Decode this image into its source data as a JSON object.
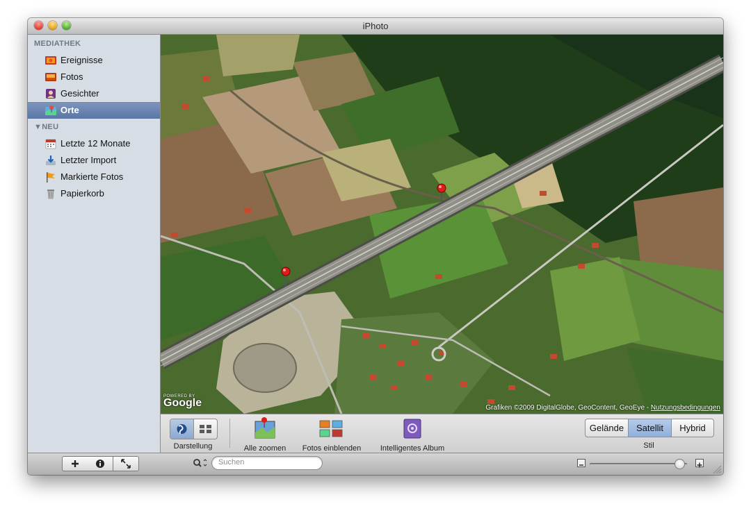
{
  "window": {
    "title": "iPhoto"
  },
  "sidebar": {
    "sections": [
      {
        "title": "MEDIATHEK",
        "items": [
          {
            "label": "Ereignisse",
            "icon": "events-icon",
            "selected": false
          },
          {
            "label": "Fotos",
            "icon": "photos-icon",
            "selected": false
          },
          {
            "label": "Gesichter",
            "icon": "faces-icon",
            "selected": false
          },
          {
            "label": "Orte",
            "icon": "places-icon",
            "selected": true
          }
        ]
      },
      {
        "title": "NEU",
        "items": [
          {
            "label": "Letzte 12 Monate",
            "icon": "calendar-icon",
            "selected": false
          },
          {
            "label": "Letzter Import",
            "icon": "import-icon",
            "selected": false
          },
          {
            "label": "Markierte Fotos",
            "icon": "flag-icon",
            "selected": false
          },
          {
            "label": "Papierkorb",
            "icon": "trash-icon",
            "selected": false
          }
        ]
      }
    ]
  },
  "map": {
    "google_caption": "POWERED BY",
    "google_logo": "Google",
    "attribution": "Grafiken ©2009 DigitalGlobe, GeoContent, GeoEye -",
    "terms_link": "Nutzungsbedingungen",
    "pins": [
      {
        "icon": "map-pin-icon"
      },
      {
        "icon": "map-pin-icon"
      }
    ]
  },
  "toolbar": {
    "darstellung": "Darstellung",
    "alle_zoomen": "Alle zoomen",
    "fotos_einblenden": "Fotos einblenden",
    "intelligentes_album": "Intelligentes Album",
    "stil": {
      "label": "Stil",
      "options": [
        "Gelände",
        "Satellit",
        "Hybrid"
      ],
      "selected": "Satellit"
    }
  },
  "bottombar": {
    "search_placeholder": "Suchen",
    "zoom_value": 0.92
  }
}
